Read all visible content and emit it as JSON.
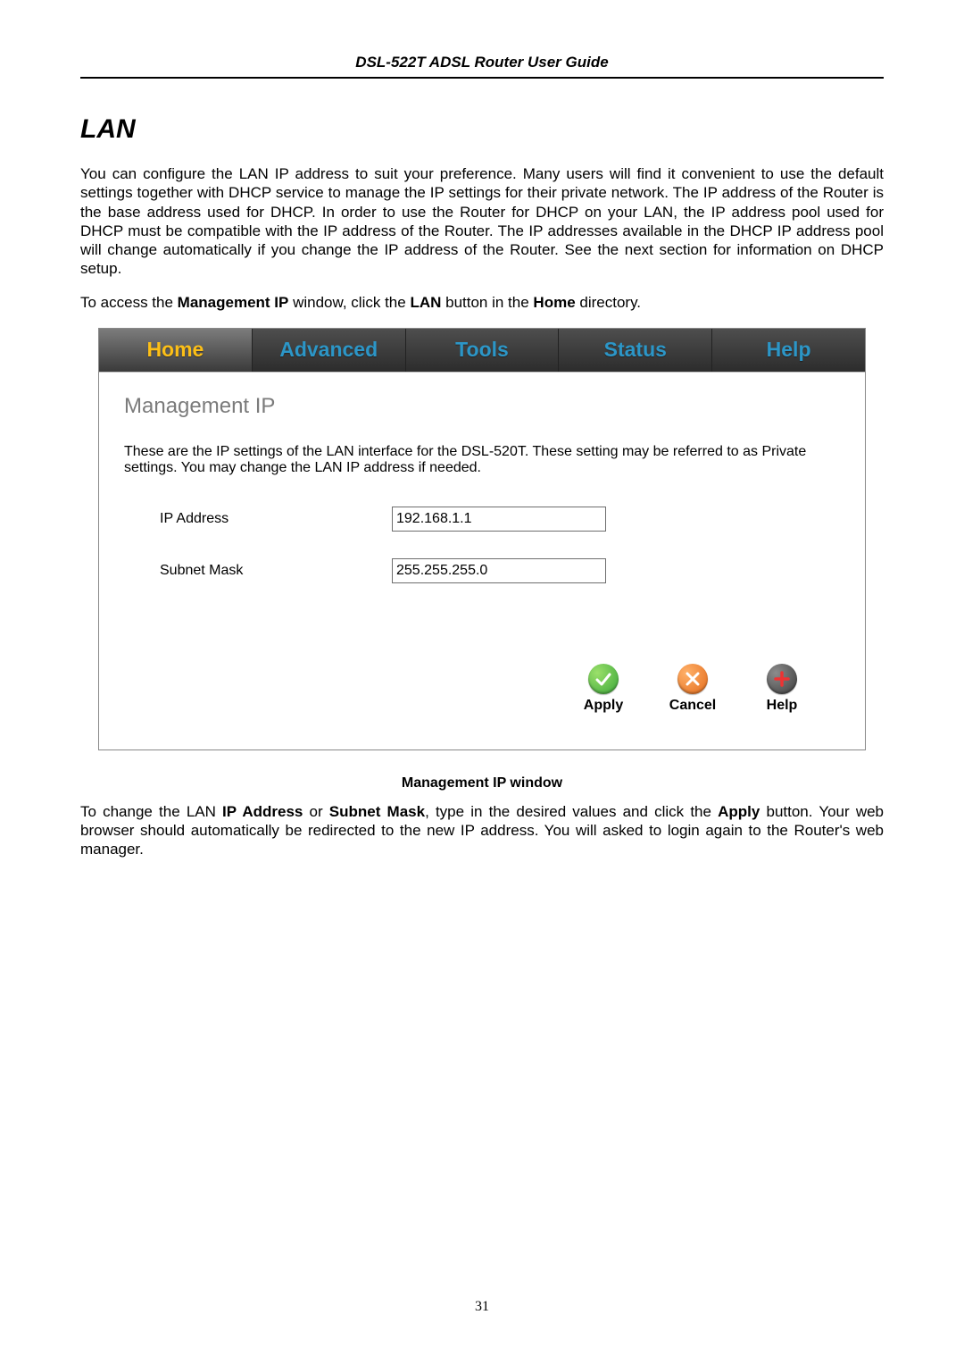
{
  "doc": {
    "header": "DSL-522T ADSL Router User Guide",
    "section_title": "LAN",
    "para1": "You can configure the LAN IP address to suit your preference. Many users will find it convenient to use the default settings together with DHCP service to manage the IP settings for their private network. The IP address of the Router is the base address used for DHCP. In order to use the Router for DHCP on your LAN, the IP address pool used for DHCP must be compatible with the IP address of the Router. The IP addresses available in the DHCP IP address pool will change automatically if you change the IP address of the Router. See the next section for information on DHCP setup.",
    "para2_pre": "To access the ",
    "para2_b1": "Management IP",
    "para2_mid": " window, click the ",
    "para2_b2": "LAN",
    "para2_mid2": " button in the ",
    "para2_b3": "Home",
    "para2_post": " directory.",
    "caption": "Management IP window",
    "para3_pre": "To change the LAN ",
    "para3_b1": "IP Address",
    "para3_mid": " or ",
    "para3_b2": "Subnet Mask",
    "para3_mid2": ", type in the desired values and click the ",
    "para3_b3": "Apply",
    "para3_post": " button. Your web browser should automatically be redirected to the new IP address. You will asked to login again to the Router's web manager.",
    "page_number": "31"
  },
  "router": {
    "tabs": {
      "home": "Home",
      "advanced": "Advanced",
      "tools": "Tools",
      "status": "Status",
      "help": "Help"
    },
    "panel_title": "Management IP",
    "panel_desc": "These are the IP settings of the LAN interface for the DSL-520T. These setting may be referred to as Private settings. You may change the LAN IP address if needed.",
    "fields": {
      "ip_label": "IP Address",
      "ip_value": "192.168.1.1",
      "mask_label": "Subnet Mask",
      "mask_value": "255.255.255.0"
    },
    "actions": {
      "apply": "Apply",
      "cancel": "Cancel",
      "help": "Help"
    }
  }
}
